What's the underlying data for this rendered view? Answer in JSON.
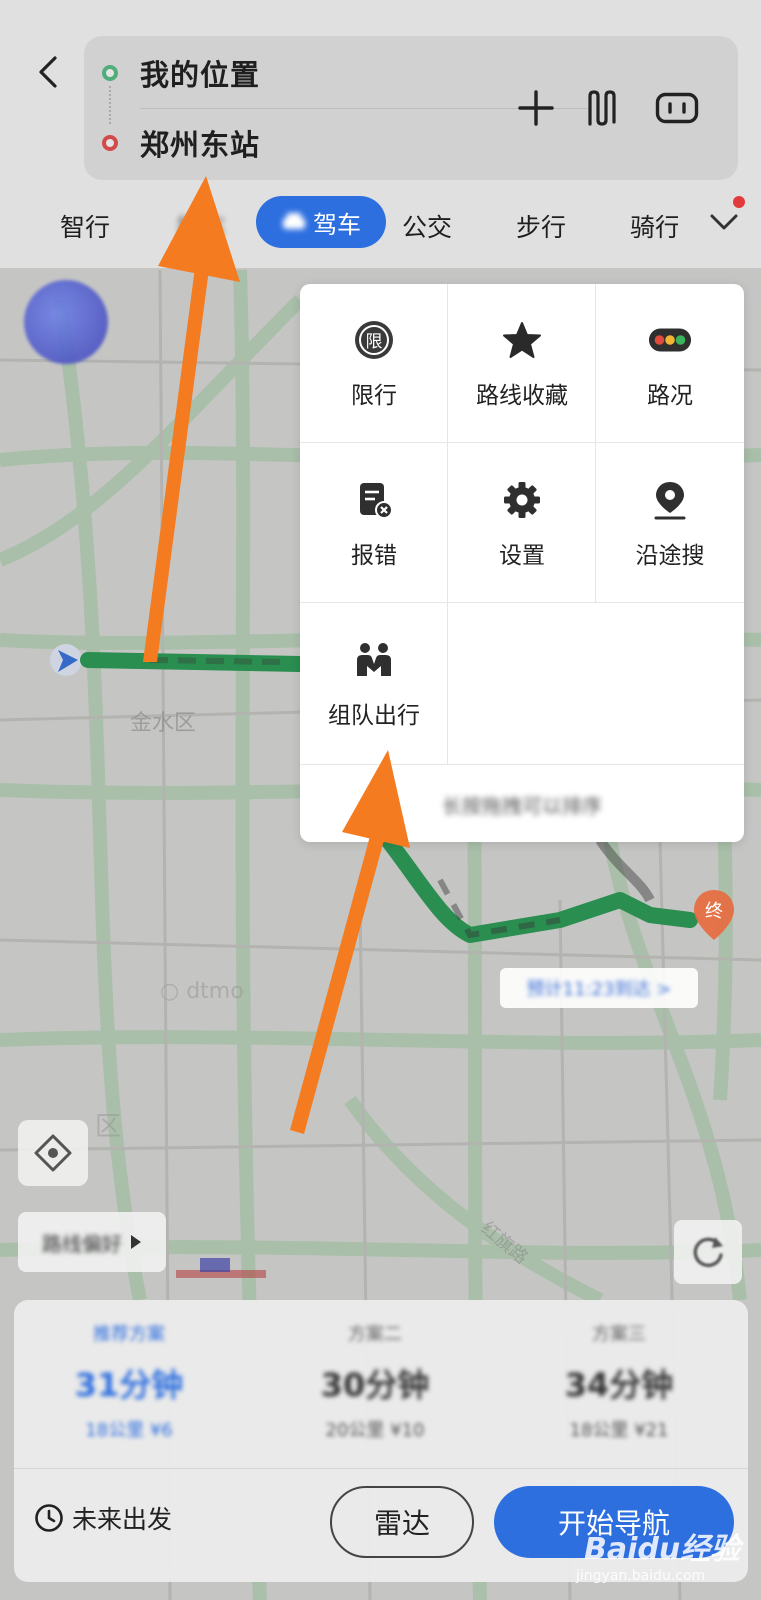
{
  "route": {
    "from": "我的位置",
    "to": "郑州东站"
  },
  "tabs": {
    "items": [
      {
        "label": "智行"
      },
      {
        "label": "打车"
      },
      {
        "label": "驾车"
      },
      {
        "label": "公交"
      },
      {
        "label": "步行"
      },
      {
        "label": "骑行"
      }
    ]
  },
  "menu": {
    "items": [
      {
        "label": "限行",
        "icon": "restriction-icon"
      },
      {
        "label": "路线收藏",
        "icon": "star-icon"
      },
      {
        "label": "路况",
        "icon": "traffic-light-icon"
      },
      {
        "label": "报错",
        "icon": "report-error-icon"
      },
      {
        "label": "设置",
        "icon": "gear-icon"
      },
      {
        "label": "沿途搜",
        "icon": "location-pin-icon"
      },
      {
        "label": "组队出行",
        "icon": "team-icon"
      }
    ],
    "footer": "长按拖拽可以排序"
  },
  "map": {
    "eta_chip": "预计11:23到达 >",
    "route_pref": "路线偏好",
    "district": "金水区"
  },
  "plans": [
    {
      "name": "推荐方案",
      "time": "31分钟",
      "info": "18公里 ¥6",
      "active": true
    },
    {
      "name": "方案二",
      "time": "30分钟",
      "info": "20公里 ¥10",
      "active": false
    },
    {
      "name": "方案三",
      "time": "34分钟",
      "info": "18公里 ¥21",
      "active": false
    }
  ],
  "actions": {
    "future": "未来出发",
    "radar": "雷达",
    "navigate": "开始导航"
  },
  "watermark": {
    "logo": "Baidu经验",
    "url": "jingyan.baidu.com"
  },
  "colors": {
    "accent": "#2e6fe0",
    "route_green": "#1f9a4d",
    "arrow_orange": "#f47b20",
    "start_dot": "#4fae7a",
    "end_dot": "#d24b4b"
  }
}
